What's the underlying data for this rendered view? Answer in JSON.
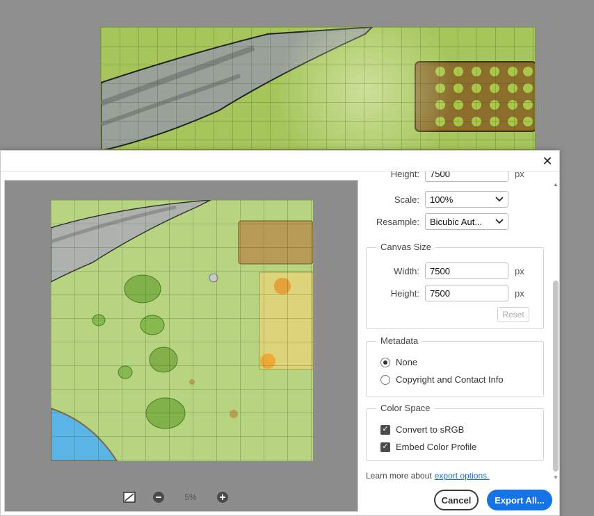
{
  "settings": {
    "scale": {
      "label": "Scale:",
      "value": "100%"
    },
    "resample": {
      "label": "Resample:",
      "value": "Bicubic Aut..."
    },
    "height_top": {
      "label": "Height:",
      "value": "7500",
      "unit": "px"
    }
  },
  "canvas_size": {
    "title": "Canvas Size",
    "width": {
      "label": "Width:",
      "value": "7500",
      "unit": "px"
    },
    "height": {
      "label": "Height:",
      "value": "7500",
      "unit": "px"
    },
    "reset_label": "Reset"
  },
  "metadata": {
    "title": "Metadata",
    "options": [
      "None",
      "Copyright and Contact Info"
    ],
    "selected": "None"
  },
  "color_space": {
    "title": "Color Space",
    "options": [
      "Convert to sRGB",
      "Embed Color Profile"
    ]
  },
  "preview": {
    "zoom": "5%"
  },
  "footer": {
    "learn_text": "Learn more about",
    "learn_link": "export options.",
    "cancel_label": "Cancel",
    "export_label": "Export All..."
  },
  "colors": {
    "accent": "#1473e6",
    "grass": "#b7d481",
    "water": "#5ab4e6"
  },
  "icons": {
    "close": "close-icon",
    "fit": "fit-screen-icon",
    "zoom_out": "zoom-out-icon",
    "zoom_in": "zoom-in-icon",
    "dropdown": "chevron-down-icon"
  }
}
